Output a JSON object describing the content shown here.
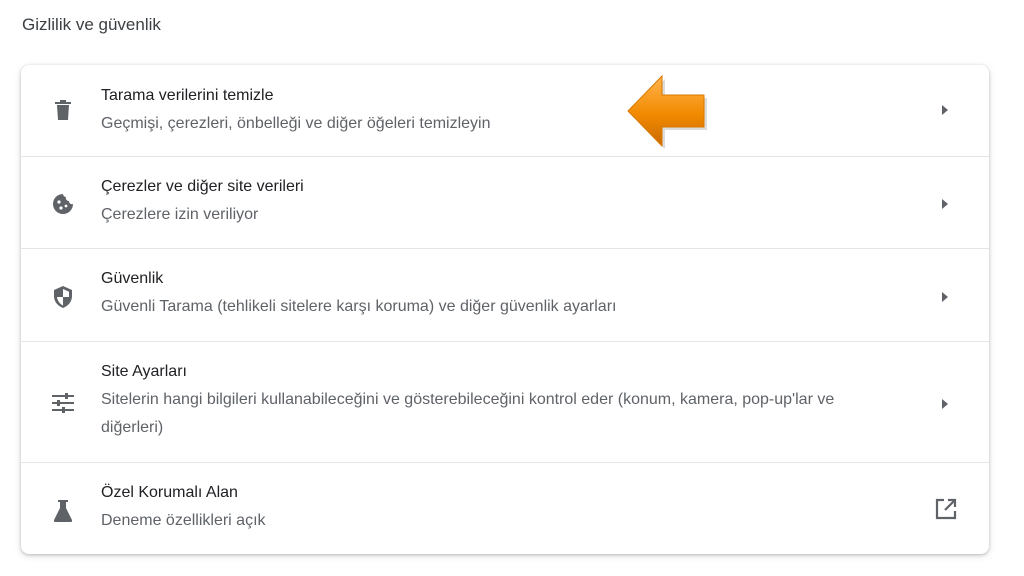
{
  "section_title": "Gizlilik ve güvenlik",
  "rows": [
    {
      "label": "Tarama verilerini temizle",
      "sub": "Geçmişi, çerezleri, önbelleği ve diğer öğeleri temizleyin",
      "icon": "trash-icon"
    },
    {
      "label": "Çerezler ve diğer site verileri",
      "sub": "Çerezlere izin veriliyor",
      "icon": "cookie-icon"
    },
    {
      "label": "Güvenlik",
      "sub": "Güvenli Tarama (tehlikeli sitelere karşı koruma) ve diğer güvenlik ayarları",
      "icon": "shield-icon"
    },
    {
      "label": "Site Ayarları",
      "sub": "Sitelerin hangi bilgileri kullanabileceğini ve gösterebileceğini kontrol eder (konum, kamera, pop-up'lar ve diğerleri)",
      "icon": "sliders-icon"
    },
    {
      "label": "Özel Korumalı Alan",
      "sub": "Deneme özellikleri açık",
      "icon": "flask-icon"
    }
  ],
  "colors": {
    "accent_arrow": "#f28a00",
    "icon": "#5f6368"
  }
}
